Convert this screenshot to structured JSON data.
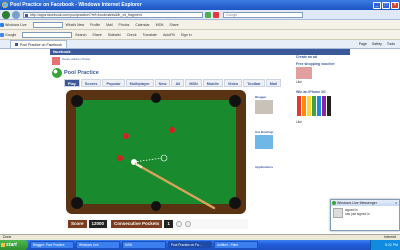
{
  "window": {
    "title": "Pool Practice on Facebook - Windows Internet Explorer"
  },
  "address": {
    "url": "http://apps.facebook.com/poolpractice/?ref=bookmarks&fb_xd_fragment",
    "search_placeholder": "Google"
  },
  "toolbar1": {
    "items": [
      "Windows Live",
      "What's New",
      "Profile",
      "Mail",
      "Photos",
      "Calendar",
      "MSN",
      "Share"
    ]
  },
  "toolbar2": {
    "items": [
      "Google",
      "Search",
      "Share",
      "Sidewiki",
      "Check",
      "Translate",
      "AutoFill",
      "Sign In"
    ]
  },
  "tab": {
    "label": "Pool Practice on Facebook"
  },
  "commands": [
    "Page",
    "Safety",
    "Tools"
  ],
  "fb": {
    "logo": "facebook"
  },
  "promo": {
    "text": "Texas Hold'em Poker"
  },
  "app": {
    "name": "Pool Practice"
  },
  "gametabs": [
    "Play",
    "Scores",
    "Popular",
    "Multiplayer",
    "New",
    "All",
    "MSN",
    "Mobile",
    "Video",
    "Toolbar",
    "Mail"
  ],
  "score": {
    "score_label": "Score",
    "score_value": "12000",
    "pockets_label": "Consecutive Pockets",
    "pockets_value": "1"
  },
  "ads": [
    {
      "title": "Create an ad",
      "body": ""
    },
    {
      "title": "Free shopping voucher",
      "body": "Like"
    },
    {
      "title": "Win an iPhone 3G",
      "body": "Like"
    }
  ],
  "sidebar": {
    "heading1": "Blogger",
    "text1": "Get Bowling!",
    "heading2": "Applications"
  },
  "messenger": {
    "title": "Windows Live Messenger",
    "line1": "signed in",
    "line2": "has just signed in"
  },
  "status": {
    "left": "Done",
    "zone": "Internet"
  },
  "taskbar": {
    "start": "start",
    "tasks": [
      "Blogger: Pool Practice",
      "Windows Live",
      "MSN",
      "Pool Practice on Fa...",
      "Untitled - Paint"
    ],
    "clock": "5:22 PM"
  },
  "colors": {
    "felt": "#1a8a2e",
    "rail": "#5a3312",
    "fb_blue": "#3b5998",
    "xp_blue": "#245edb"
  }
}
